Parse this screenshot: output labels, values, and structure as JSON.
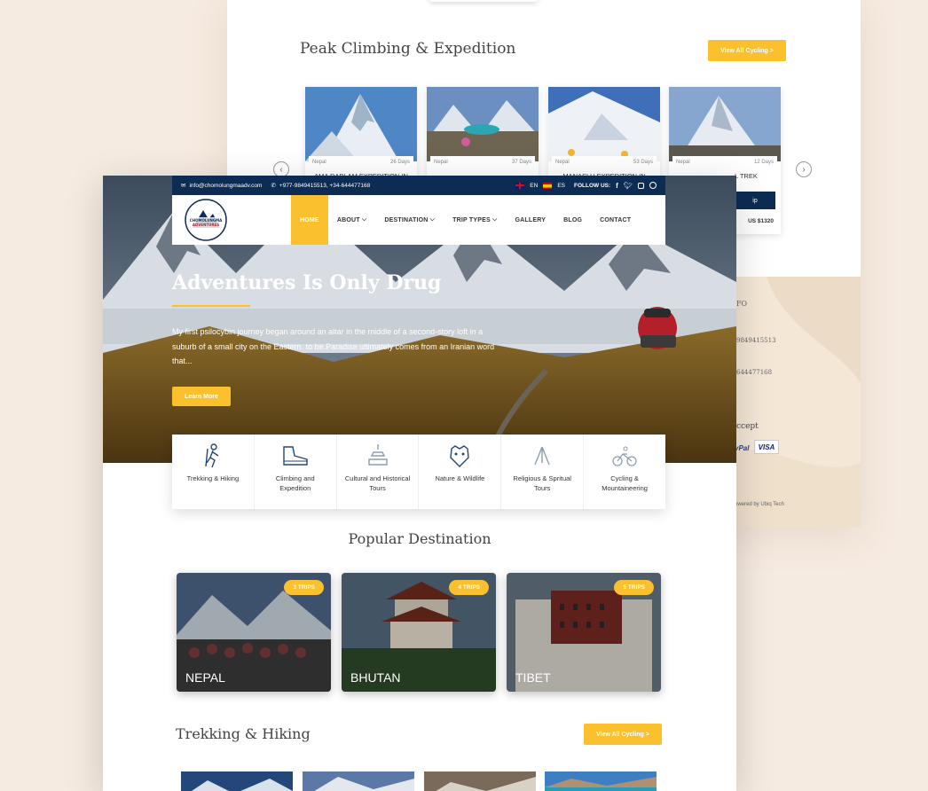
{
  "back_page": {
    "section_title": "Peak Climbing & Expedition",
    "view_all": "View All Cycling >",
    "cards": [
      {
        "country": "Nepal",
        "days": "26 Days",
        "name": "AMA DABLAM EXPEDITION IN"
      },
      {
        "country": "Nepal",
        "days": "37 Days",
        "name": ""
      },
      {
        "country": "Nepal",
        "days": "53 Days",
        "name": "MANASLU EXPEDITION IN"
      },
      {
        "country": "Nepal",
        "days": "12 Days",
        "name": "L TREK",
        "button": "ip",
        "price": "US $1320"
      }
    ],
    "footer": {
      "info": "FO",
      "phone1": "9849415513",
      "phone2": "644477168",
      "accept": "ccept",
      "paypal": "yPal",
      "visa": "VISA",
      "powered": "owered by Ubiq Tech"
    }
  },
  "topbar": {
    "email": "info@chomolungmaadv.com",
    "phone": "+977-9849415513, +34-644477168",
    "lang_en": "EN",
    "lang_es": "ES",
    "follow": "FOLLOW US:"
  },
  "logo": {
    "line1": "CHOMOLUNGMA",
    "line2": "ADVENTURES"
  },
  "nav": [
    {
      "label": "HOME",
      "active": true
    },
    {
      "label": "ABOUT",
      "dropdown": true
    },
    {
      "label": "DESTINATION",
      "dropdown": true
    },
    {
      "label": "TRIP TYPES",
      "dropdown": true
    },
    {
      "label": "GALLERY"
    },
    {
      "label": "BLOG"
    },
    {
      "label": "CONTACT"
    }
  ],
  "hero": {
    "title": "Adventures Is Only Drug",
    "text": "My first psilocybin journey began around an altar in the middle of a second-story loft in a suburb of a small city on the Eastern. to be.Paradise ultimately comes from an Iranian word that...",
    "button": "Learn More"
  },
  "categories": [
    {
      "label": "Trekking & Hiking",
      "icon": "hiker-icon"
    },
    {
      "label": "Climbing and Expedition",
      "icon": "boot-icon"
    },
    {
      "label": "Cultural and Historical Tours",
      "icon": "stupa-icon"
    },
    {
      "label": "Nature & Wildlife",
      "icon": "tiger-icon"
    },
    {
      "label": "Religious & Spritual Tours",
      "icon": "praying-hands-icon"
    },
    {
      "label": "Cycling & Mountaineering",
      "icon": "cyclist-icon"
    }
  ],
  "popular": {
    "title": "Popular Destination",
    "destinations": [
      {
        "name": "NEPAL",
        "trips": "3 TRIPS"
      },
      {
        "name": "BHUTAN",
        "trips": "4 TRIPS"
      },
      {
        "name": "TIBET",
        "trips": "5 TRIPS"
      }
    ]
  },
  "trekking": {
    "title": "Trekking & Hiking",
    "view_all": "View All Cycling >"
  },
  "colors": {
    "accent": "#fbc02d",
    "navy": "#0d2c54"
  }
}
